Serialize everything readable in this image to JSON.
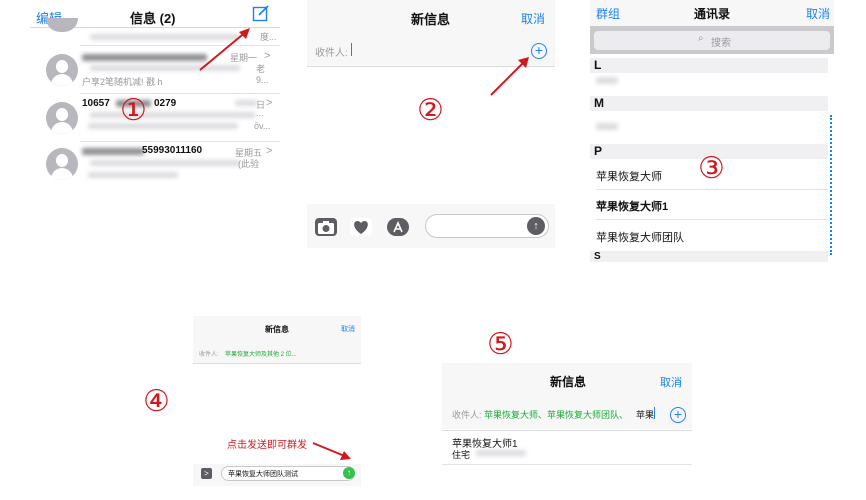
{
  "panel1": {
    "edit_label": "编辑",
    "title": "信息 (2)",
    "rows": [
      {
        "time": "星期一",
        "preview": "户享2笔随机减! 戳 h",
        "tail": "老",
        "tail2": "9..."
      },
      {
        "sender": "10657",
        "sender2": "0279",
        "time": "日",
        "tail": "...",
        "tail2": "ōv..."
      },
      {
        "sender": "55993011160",
        "time": "星期五",
        "tail": "(此验"
      }
    ],
    "step": "①"
  },
  "panel2": {
    "title": "新信息",
    "cancel": "取消",
    "recipient_label": "收件人:",
    "step": "②"
  },
  "panel3": {
    "group": "群组",
    "title": "通讯录",
    "cancel": "取消",
    "search_placeholder": "搜索",
    "sections": [
      "L",
      "M",
      "P",
      "S"
    ],
    "contacts": [
      "苹果恢复大师",
      "苹果恢复大师1",
      "苹果恢复大师团队"
    ],
    "step": "③"
  },
  "panel4": {
    "title": "新信息",
    "cancel": "取消",
    "recipient_label": "收件人:",
    "recipients": "苹果恢复大师及其他 2 位...",
    "hint": "点击发送即可群发",
    "message": "苹果恢复大师团队测试",
    "step": "④"
  },
  "panel5": {
    "title": "新信息",
    "cancel": "取消",
    "recipient_label": "收件人:",
    "recipients": "苹果恢复大师、苹果恢复大师团队、",
    "typing": "苹果",
    "suggestion_name": "苹果恢复大师1",
    "suggestion_type": "住宅",
    "step": "⑤"
  },
  "colors": {
    "ios_blue": "#1a82f5",
    "annotation_red": "#d0191e",
    "recipient_green": "#19a834",
    "send_green": "#32c24d"
  }
}
